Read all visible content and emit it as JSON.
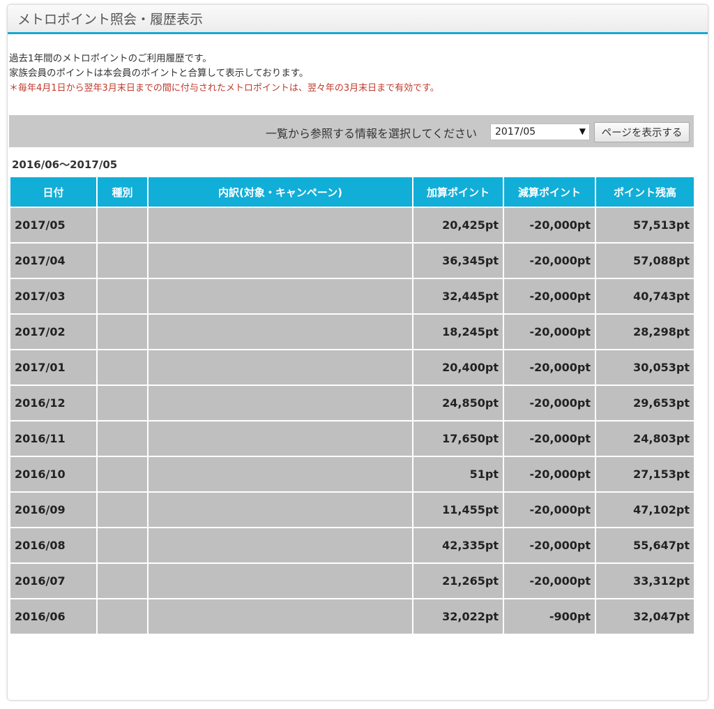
{
  "header": {
    "title": "メトロポイント照会・履歴表示"
  },
  "intro": {
    "line1": "過去1年間のメトロポイントのご利用履歴です。",
    "line2": "家族会員のポイントは本会員のポイントと合算して表示しております。",
    "note": "＊毎年4月1日から翌年3月末日までの間に付与されたメトロポイントは、翌々年の3月末日まで有効です。"
  },
  "selector": {
    "label": "一覧から参照する情報を選択してください",
    "selected": "2017/05",
    "button": "ページを表示する"
  },
  "period": "2016/06～2017/05",
  "table": {
    "columns": [
      "日付",
      "種別",
      "内訳(対象・キャンペーン)",
      "加算ポイント",
      "減算ポイント",
      "ポイント残高"
    ],
    "rows": [
      {
        "date": "2017/05",
        "type": "",
        "detail": "",
        "add": "20,425pt",
        "sub": "-20,000pt",
        "balance": "57,513pt"
      },
      {
        "date": "2017/04",
        "type": "",
        "detail": "",
        "add": "36,345pt",
        "sub": "-20,000pt",
        "balance": "57,088pt"
      },
      {
        "date": "2017/03",
        "type": "",
        "detail": "",
        "add": "32,445pt",
        "sub": "-20,000pt",
        "balance": "40,743pt"
      },
      {
        "date": "2017/02",
        "type": "",
        "detail": "",
        "add": "18,245pt",
        "sub": "-20,000pt",
        "balance": "28,298pt"
      },
      {
        "date": "2017/01",
        "type": "",
        "detail": "",
        "add": "20,400pt",
        "sub": "-20,000pt",
        "balance": "30,053pt"
      },
      {
        "date": "2016/12",
        "type": "",
        "detail": "",
        "add": "24,850pt",
        "sub": "-20,000pt",
        "balance": "29,653pt"
      },
      {
        "date": "2016/11",
        "type": "",
        "detail": "",
        "add": "17,650pt",
        "sub": "-20,000pt",
        "balance": "24,803pt"
      },
      {
        "date": "2016/10",
        "type": "",
        "detail": "",
        "add": "51pt",
        "sub": "-20,000pt",
        "balance": "27,153pt"
      },
      {
        "date": "2016/09",
        "type": "",
        "detail": "",
        "add": "11,455pt",
        "sub": "-20,000pt",
        "balance": "47,102pt"
      },
      {
        "date": "2016/08",
        "type": "",
        "detail": "",
        "add": "42,335pt",
        "sub": "-20,000pt",
        "balance": "55,647pt"
      },
      {
        "date": "2016/07",
        "type": "",
        "detail": "",
        "add": "21,265pt",
        "sub": "-20,000pt",
        "balance": "33,312pt"
      },
      {
        "date": "2016/06",
        "type": "",
        "detail": "",
        "add": "32,022pt",
        "sub": "-900pt",
        "balance": "32,047pt"
      }
    ]
  },
  "colors": {
    "accent": "#11aed8",
    "row_bg": "#bfbfbf",
    "note": "#c0392b",
    "select_bar": "#c8c8c8"
  },
  "icons": {
    "dropdown": "triangle-down-icon"
  }
}
